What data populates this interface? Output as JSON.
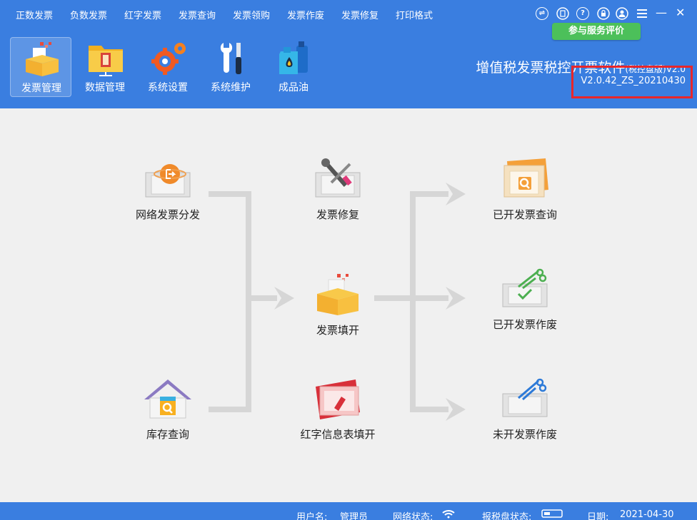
{
  "menu": [
    "正数发票",
    "负数发票",
    "红字发票",
    "发票查询",
    "发票领购",
    "发票作废",
    "发票修复",
    "打印格式"
  ],
  "window_controls": {
    "icons": [
      "switch-icon",
      "note-icon",
      "help-icon",
      "lock-icon",
      "user-icon",
      "menu-icon",
      "minimize-icon",
      "close-icon"
    ],
    "help_glyph": "?",
    "minimize_glyph": "—",
    "close_glyph": "✕"
  },
  "rate_button": "参与服务评价",
  "toolbar": [
    {
      "label": "发票管理",
      "icon": "invoice-box-icon",
      "active": true
    },
    {
      "label": "数据管理",
      "icon": "folder-icon",
      "active": false
    },
    {
      "label": "系统设置",
      "icon": "gears-icon",
      "active": false
    },
    {
      "label": "系统维护",
      "icon": "tools-icon",
      "active": false
    },
    {
      "label": "成品油",
      "icon": "oil-icon",
      "active": false
    }
  ],
  "app_title": {
    "main": "增值税发票税控开票软件",
    "suffix": "(税控盘版)V2.0"
  },
  "version": "V2.0.42_ZS_20210430",
  "flow": {
    "network_dist": "网络发票分发",
    "stock_query": "库存查询",
    "invoice_repair": "发票修复",
    "invoice_fill": "发票填开",
    "red_info_fill": "红字信息表填开",
    "issued_query": "已开发票查询",
    "issued_void": "已开发票作废",
    "unissued_void": "未开发票作废"
  },
  "status": {
    "user_label": "用户名:",
    "user_value": "管理员",
    "net_label": "网络状态:",
    "disk_label": "报税盘状态:",
    "date_label": "日期:",
    "date_value": "2021-04-30"
  },
  "colors": {
    "header": "#3a7ee0",
    "accent_green": "#4cc05a",
    "highlight_red": "#e8262a",
    "flow_line": "#d6d6d6"
  }
}
